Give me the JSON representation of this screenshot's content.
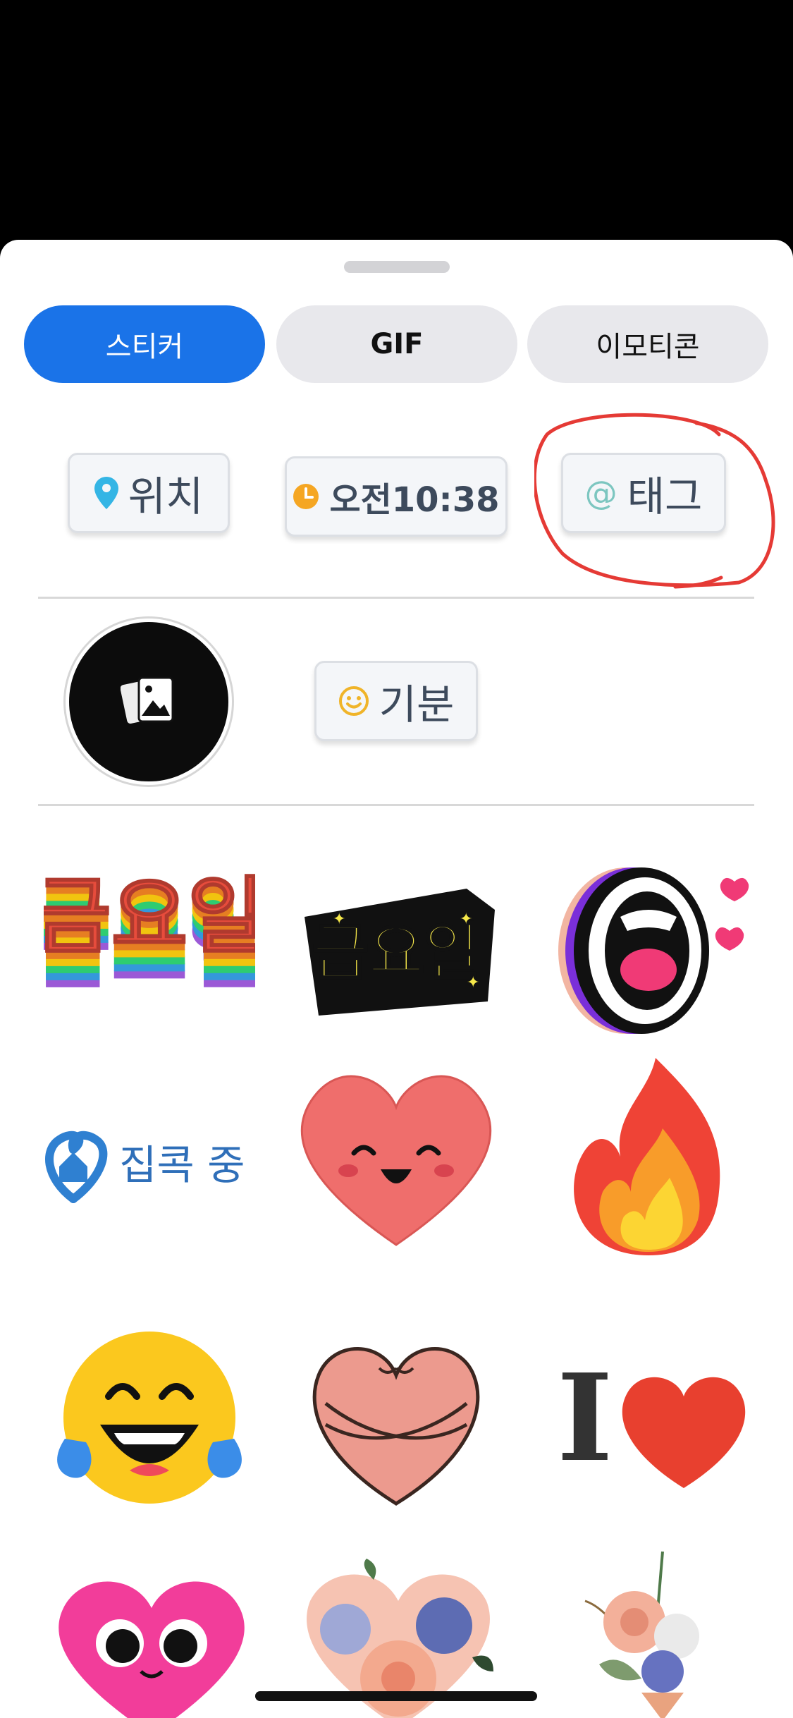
{
  "tabs": [
    {
      "label": "스티커",
      "active": true
    },
    {
      "label": "GIF",
      "active": false
    },
    {
      "label": "이모티콘",
      "active": false
    }
  ],
  "chips": {
    "location": {
      "label": "위치",
      "icon": "location-pin-icon"
    },
    "time": {
      "label": "오전10:38",
      "icon": "clock-icon"
    },
    "tag": {
      "label": "태그",
      "icon": "at-sign-icon"
    },
    "mood": {
      "label": "기분",
      "icon": "smiley-icon"
    }
  },
  "photo_sticker": {
    "icon": "photos-icon"
  },
  "stickers": {
    "friday_rainbow": "금요일",
    "friday_stars": "금요일",
    "home_label": "집콕 중",
    "items": [
      "shouting-mouth",
      "smiling-heart",
      "fire",
      "laughing-tears-face",
      "hugging-heart",
      "i-love",
      "pink-heart-eyes",
      "flower-heart",
      "flower-bouquet"
    ],
    "i_love_letter": "I"
  },
  "colors": {
    "accent": "#1a73e8",
    "annotation": "#e53a35"
  }
}
